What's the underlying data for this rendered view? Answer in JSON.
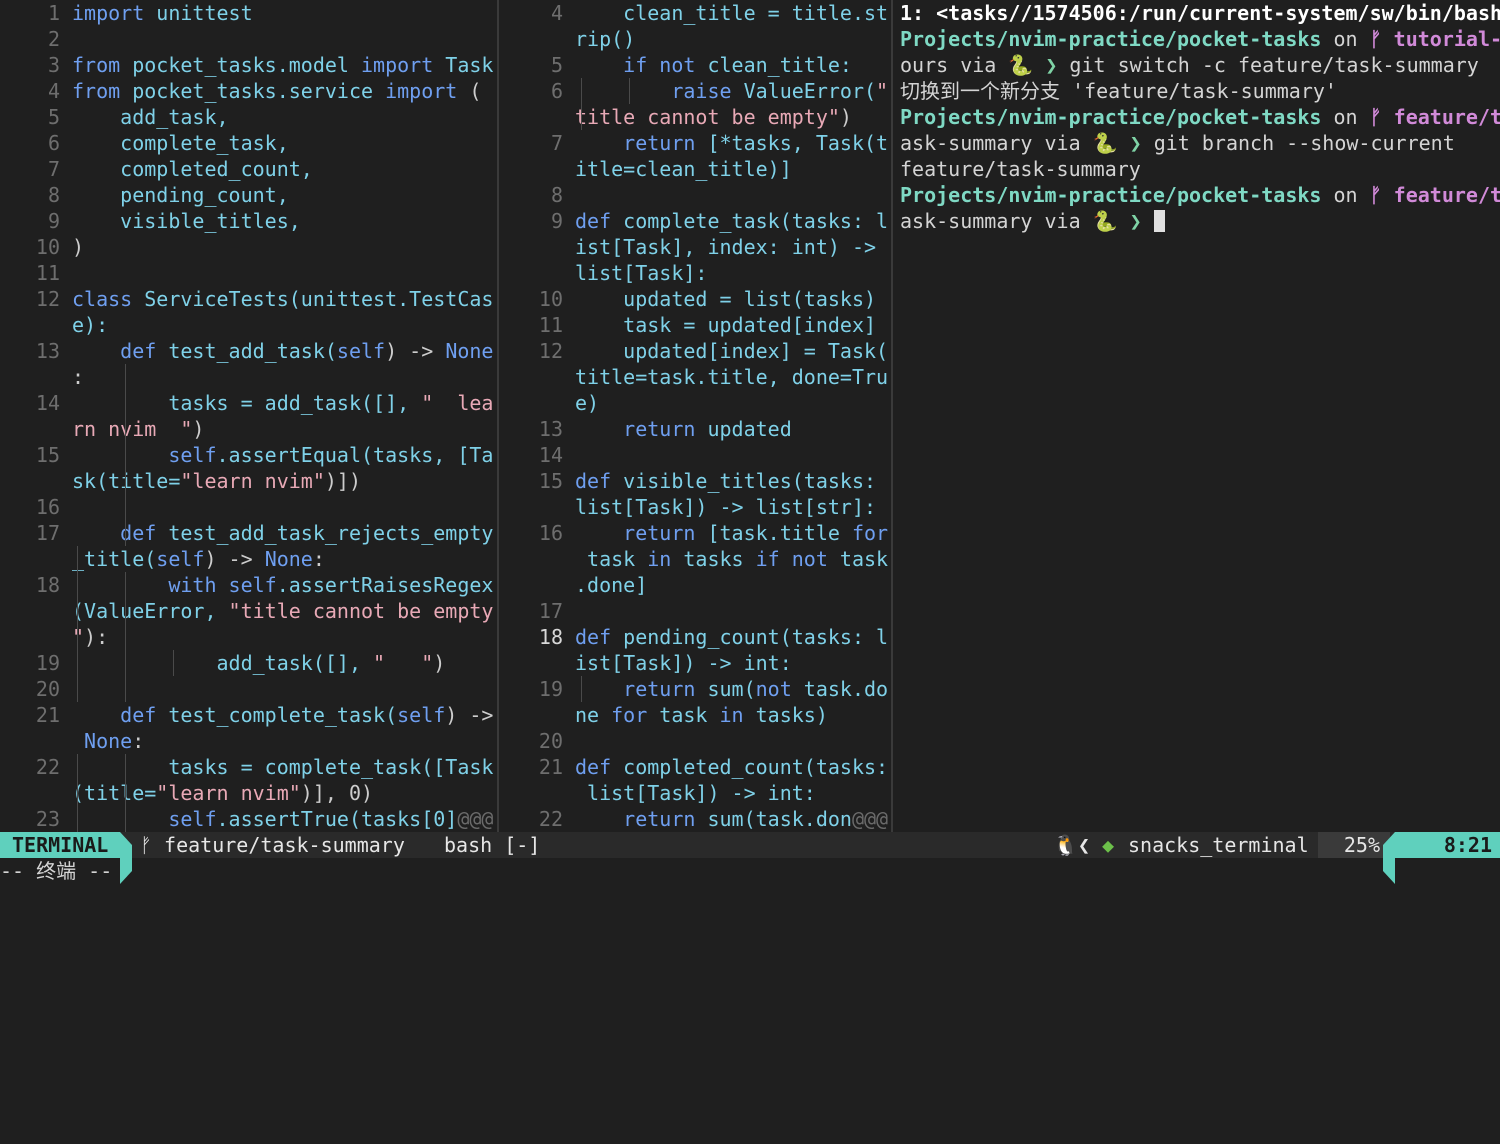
{
  "left_lines": [
    {
      "num": "1",
      "text": [
        [
          "import",
          "k"
        ],
        [
          " unittest",
          "n"
        ]
      ]
    },
    {
      "num": "2",
      "text": []
    },
    {
      "num": "3",
      "text": [
        [
          "from",
          "k"
        ],
        [
          " pocket_tasks.model ",
          "n"
        ],
        [
          "import",
          "k"
        ],
        [
          " Task",
          "n"
        ]
      ]
    },
    {
      "num": "4",
      "text": [
        [
          "from",
          "k"
        ],
        [
          " pocket_tasks.service ",
          "n"
        ],
        [
          "import",
          "k"
        ],
        [
          " (",
          "d"
        ]
      ]
    },
    {
      "num": "5",
      "text": [
        [
          "    add_task,",
          "n"
        ]
      ]
    },
    {
      "num": "6",
      "text": [
        [
          "    complete_task,",
          "n"
        ]
      ]
    },
    {
      "num": "7",
      "text": [
        [
          "    completed_count,",
          "n"
        ]
      ]
    },
    {
      "num": "8",
      "text": [
        [
          "    pending_count,",
          "n"
        ]
      ]
    },
    {
      "num": "9",
      "text": [
        [
          "    visible_titles,",
          "n"
        ]
      ]
    },
    {
      "num": "10",
      "text": [
        [
          ")",
          "d"
        ]
      ]
    },
    {
      "num": "11",
      "text": []
    },
    {
      "num": "12",
      "text": [
        [
          "class",
          "k"
        ],
        [
          " ServiceTests(unittest.TestCas",
          "n"
        ]
      ]
    },
    {
      "num": "",
      "text": [
        [
          "e):",
          "n"
        ]
      ]
    },
    {
      "num": "13",
      "text": [
        [
          "    ",
          "n"
        ],
        [
          "def",
          "k"
        ],
        [
          " test_add_task(",
          "n"
        ],
        [
          "self",
          "k"
        ],
        [
          ") -> ",
          "d"
        ],
        [
          "None",
          "k"
        ]
      ]
    },
    {
      "num": "",
      "text": [
        [
          ":",
          "d"
        ]
      ]
    },
    {
      "num": "14",
      "text": [
        [
          "        tasks = add_task([], ",
          "n"
        ],
        [
          "\"  lea",
          "s"
        ]
      ]
    },
    {
      "num": "",
      "text": [
        [
          "rn nvim  \"",
          "s"
        ],
        [
          ")",
          "d"
        ]
      ]
    },
    {
      "num": "15",
      "text": [
        [
          "        ",
          "n"
        ],
        [
          "self",
          "k"
        ],
        [
          ".assertEqual(tasks, [Ta",
          "n"
        ]
      ]
    },
    {
      "num": "",
      "text": [
        [
          "sk(title=",
          "n"
        ],
        [
          "\"learn nvim\"",
          "s"
        ],
        [
          ")])",
          "d"
        ]
      ]
    },
    {
      "num": "16",
      "text": []
    },
    {
      "num": "17",
      "text": [
        [
          "    ",
          "n"
        ],
        [
          "def",
          "k"
        ],
        [
          " test_add_task_rejects_empty",
          "n"
        ]
      ]
    },
    {
      "num": "",
      "text": [
        [
          "_title(",
          "n"
        ],
        [
          "self",
          "k"
        ],
        [
          ") -> ",
          "d"
        ],
        [
          "None",
          "k"
        ],
        [
          ":",
          "d"
        ]
      ]
    },
    {
      "num": "18",
      "text": [
        [
          "        ",
          "n"
        ],
        [
          "with",
          "k"
        ],
        [
          " ",
          "n"
        ],
        [
          "self",
          "k"
        ],
        [
          ".assertRaisesRegex",
          "n"
        ]
      ]
    },
    {
      "num": "",
      "text": [
        [
          "(ValueError, ",
          "n"
        ],
        [
          "\"title cannot be empty",
          "s"
        ]
      ]
    },
    {
      "num": "",
      "text": [
        [
          "\"",
          "s"
        ],
        [
          "):",
          "d"
        ]
      ]
    },
    {
      "num": "19",
      "text": [
        [
          "            add_task([], ",
          "n"
        ],
        [
          "\"   \"",
          "s"
        ],
        [
          ")",
          "d"
        ]
      ]
    },
    {
      "num": "20",
      "text": []
    },
    {
      "num": "21",
      "text": [
        [
          "    ",
          "n"
        ],
        [
          "def",
          "k"
        ],
        [
          " test_complete_task(",
          "n"
        ],
        [
          "self",
          "k"
        ],
        [
          ") ->",
          "d"
        ]
      ]
    },
    {
      "num": "",
      "text": [
        [
          " None",
          "k"
        ],
        [
          ":",
          "d"
        ]
      ]
    },
    {
      "num": "22",
      "text": [
        [
          "        tasks = complete_task([Task",
          "n"
        ]
      ]
    },
    {
      "num": "",
      "text": [
        [
          "(title=",
          "n"
        ],
        [
          "\"learn nvim\"",
          "s"
        ],
        [
          ")], 0)",
          "d"
        ]
      ]
    },
    {
      "num": "23",
      "text": [
        [
          "        ",
          "n"
        ],
        [
          "self",
          "k"
        ],
        [
          ".assertTrue(tasks[0]",
          "n"
        ],
        [
          "@@@",
          "ov"
        ]
      ]
    }
  ],
  "mid_lines": [
    {
      "num": "4",
      "text": [
        [
          "    clean_title = title.st",
          "n"
        ]
      ]
    },
    {
      "num": "",
      "text": [
        [
          "rip()",
          "n"
        ]
      ]
    },
    {
      "num": "5",
      "text": [
        [
          "    ",
          "n"
        ],
        [
          "if not",
          "k"
        ],
        [
          " clean_title:",
          "n"
        ]
      ]
    },
    {
      "num": "6",
      "text": [
        [
          "        ",
          "n"
        ],
        [
          "raise",
          "k"
        ],
        [
          " ValueError(",
          "n"
        ],
        [
          "\"",
          "s"
        ]
      ]
    },
    {
      "num": "",
      "text": [
        [
          "title cannot be empty\"",
          "s"
        ],
        [
          ")",
          "d"
        ]
      ]
    },
    {
      "num": "7",
      "text": [
        [
          "    ",
          "n"
        ],
        [
          "return",
          "k"
        ],
        [
          " [*tasks, Task(t",
          "n"
        ]
      ]
    },
    {
      "num": "",
      "text": [
        [
          "itle=clean_title)]",
          "n"
        ]
      ]
    },
    {
      "num": "8",
      "text": []
    },
    {
      "num": "9",
      "text": [
        [
          "def",
          "k"
        ],
        [
          " complete_task(tasks: l",
          "n"
        ]
      ]
    },
    {
      "num": "",
      "text": [
        [
          "ist[Task], index: int) ->",
          "n"
        ]
      ]
    },
    {
      "num": "",
      "text": [
        [
          "list[Task]:",
          "n"
        ]
      ]
    },
    {
      "num": "10",
      "text": [
        [
          "    updated = list(tasks)",
          "n"
        ]
      ]
    },
    {
      "num": "11",
      "text": [
        [
          "    task = updated[index]",
          "n"
        ]
      ]
    },
    {
      "num": "12",
      "text": [
        [
          "    updated[index] = Task(",
          "n"
        ]
      ]
    },
    {
      "num": "",
      "text": [
        [
          "title=task.title, done=Tru",
          "n"
        ]
      ]
    },
    {
      "num": "",
      "text": [
        [
          "e)",
          "n"
        ]
      ]
    },
    {
      "num": "13",
      "text": [
        [
          "    ",
          "n"
        ],
        [
          "return",
          "k"
        ],
        [
          " updated",
          "n"
        ]
      ]
    },
    {
      "num": "14",
      "text": []
    },
    {
      "num": "15",
      "text": [
        [
          "def",
          "k"
        ],
        [
          " visible_titles(tasks:",
          "n"
        ]
      ]
    },
    {
      "num": "",
      "text": [
        [
          "list[Task]) -> list[str]:",
          "n"
        ]
      ]
    },
    {
      "num": "16",
      "text": [
        [
          "    ",
          "n"
        ],
        [
          "return",
          "k"
        ],
        [
          " [task.title ",
          "n"
        ],
        [
          "for",
          "k"
        ]
      ]
    },
    {
      "num": "",
      "text": [
        [
          " task ",
          "n"
        ],
        [
          "in",
          "k"
        ],
        [
          " tasks ",
          "n"
        ],
        [
          "if not",
          "k"
        ],
        [
          " task",
          "n"
        ]
      ]
    },
    {
      "num": "",
      "text": [
        [
          ".done]",
          "n"
        ]
      ]
    },
    {
      "num": "17",
      "text": []
    },
    {
      "num": "18",
      "cur": true,
      "text": [
        [
          "def",
          "k"
        ],
        [
          " pending_count(tasks: l",
          "n"
        ]
      ]
    },
    {
      "num": "",
      "text": [
        [
          "ist[Task]) -> int:",
          "n"
        ]
      ]
    },
    {
      "num": "19",
      "text": [
        [
          "    ",
          "n"
        ],
        [
          "return",
          "k"
        ],
        [
          " sum(",
          "n"
        ],
        [
          "not",
          "k"
        ],
        [
          " task.do",
          "n"
        ]
      ]
    },
    {
      "num": "",
      "text": [
        [
          "ne ",
          "n"
        ],
        [
          "for",
          "k"
        ],
        [
          " task ",
          "n"
        ],
        [
          "in",
          "k"
        ],
        [
          " tasks)",
          "n"
        ]
      ]
    },
    {
      "num": "20",
      "text": []
    },
    {
      "num": "21",
      "text": [
        [
          "def",
          "k"
        ],
        [
          " completed_count(tasks:",
          "n"
        ]
      ]
    },
    {
      "num": "",
      "text": [
        [
          " list[Task]) -> int:",
          "n"
        ]
      ]
    },
    {
      "num": "22",
      "text": [
        [
          "    ",
          "n"
        ],
        [
          "return",
          "k"
        ],
        [
          " sum(task.don",
          "n"
        ],
        [
          "@@@",
          "ov"
        ]
      ]
    }
  ],
  "terminal": {
    "header": "1: <tasks//1574506:/run/current-system/sw/bin/bash",
    "path": "Projects/nvim-practice/pocket-tasks",
    "on": " on ",
    "branch_icon": "ᚠ",
    "branch_old": " tutorial-",
    "branch_old_rest": "ours",
    "branch_new": " feature/t",
    "branch_new_rest": "ask-summary",
    "via": " via ",
    "snake": "🐍",
    "prompt_char": " ❯ ",
    "cmd1": "git switch -c feature/task-summary",
    "out1": "切换到一个新分支 'feature/task-summary'",
    "cmd2": "git branch --show-current",
    "out2": "feature/task-summary"
  },
  "status": {
    "mode": "TERMINAL",
    "branch_icon": "ᚠ",
    "branch": "feature/task-summary",
    "file": "bash [-]",
    "penguin": "🐧",
    "lt": "❮",
    "leaf": "◆",
    "filetype": "snacks_terminal",
    "percent": "25%",
    "position": "8:21"
  },
  "cmdline": "-- 终端 --"
}
